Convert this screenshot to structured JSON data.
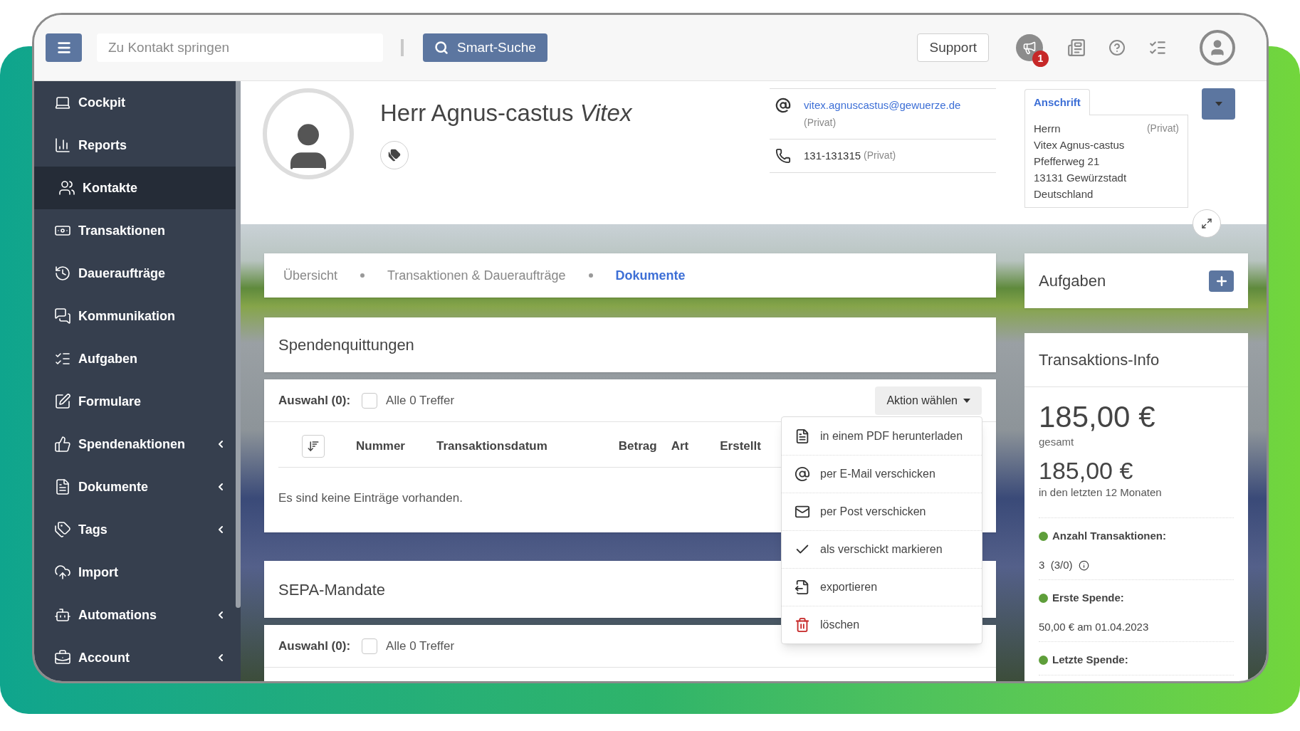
{
  "header": {
    "search": {
      "placeholder": "Zu Kontakt springen"
    },
    "smart_search": "Smart-Suche",
    "support": "Support",
    "notification_count": "1"
  },
  "sidebar": {
    "items": [
      {
        "label": "Cockpit",
        "selected": false,
        "has_submenu": false
      },
      {
        "label": "Reports",
        "selected": false,
        "has_submenu": false
      },
      {
        "label": "Kontakte",
        "selected": true,
        "has_submenu": false
      },
      {
        "label": "Transaktionen",
        "selected": false,
        "has_submenu": false
      },
      {
        "label": "Daueraufträge",
        "selected": false,
        "has_submenu": false
      },
      {
        "label": "Kommunikation",
        "selected": false,
        "has_submenu": false
      },
      {
        "label": "Aufgaben",
        "selected": false,
        "has_submenu": false
      },
      {
        "label": "Formulare",
        "selected": false,
        "has_submenu": false
      },
      {
        "label": "Spendenaktionen",
        "selected": false,
        "has_submenu": true
      },
      {
        "label": "Dokumente",
        "selected": false,
        "has_submenu": true
      },
      {
        "label": "Tags",
        "selected": false,
        "has_submenu": true
      },
      {
        "label": "Import",
        "selected": false,
        "has_submenu": false
      },
      {
        "label": "Automations",
        "selected": false,
        "has_submenu": true
      },
      {
        "label": "Account",
        "selected": false,
        "has_submenu": true
      }
    ]
  },
  "profile": {
    "name": "Herr Agnus-castus *Vitex*",
    "email": "vitex.agnuscastus@gewuerze.de",
    "email_type": "(Privat)",
    "phone": "131-131315",
    "phone_type": "(Privat)"
  },
  "address": {
    "tab": "Anschrift",
    "type": "(Privat)",
    "lines": [
      "Herrn",
      "Vitex Agnus-castus",
      "Pfefferweg 21",
      "13131 Gewürzstadt",
      "Deutschland"
    ]
  },
  "tabs": [
    {
      "label": "Übersicht",
      "selected": false
    },
    {
      "label": "Transaktionen & Daueraufträge",
      "selected": false
    },
    {
      "label": "Dokumente",
      "selected": true
    }
  ],
  "receipts": {
    "title": "Spendenquittungen",
    "selection_label": "Auswahl (0):",
    "select_all_checked": false,
    "select_all_label": "Alle 0 Treffer",
    "action": "Aktion wählen",
    "columns": [
      "Nummer",
      "Transaktionsdatum",
      "Betrag",
      "Art",
      "Erstellt"
    ],
    "empty": "Es sind keine Einträge vorhanden."
  },
  "action_menu": [
    {
      "label": "in einem PDF herunterladen",
      "kind": "normal"
    },
    {
      "label": "per E-Mail verschicken",
      "kind": "normal"
    },
    {
      "label": "per Post verschicken",
      "kind": "normal"
    },
    {
      "label": "als verschickt markieren",
      "kind": "normal"
    },
    {
      "label": "exportieren",
      "kind": "normal"
    },
    {
      "label": "löschen",
      "kind": "danger"
    }
  ],
  "sepa": {
    "title": "SEPA-Mandate",
    "selection_label": "Auswahl (0):",
    "select_all_checked": false,
    "select_all_label": "Alle 0 Treffer"
  },
  "tasks": {
    "title": "Aufgaben"
  },
  "info": {
    "title": "Transaktions-Info",
    "total": "185,00 €",
    "total_label": "gesamt",
    "recent": "185,00 €",
    "recent_label": "in den letzten 12 Monaten",
    "stats": [
      {
        "label": "Anzahl Transaktionen:",
        "value": "3  (3/0)",
        "color": "#5e9e3a"
      },
      {
        "label": "Erste Spende:",
        "value": "50,00 € am 01.04.2023",
        "color": "#5e9e3a"
      },
      {
        "label": "Letzte Spende:",
        "color": "#5e9e3a"
      }
    ]
  }
}
